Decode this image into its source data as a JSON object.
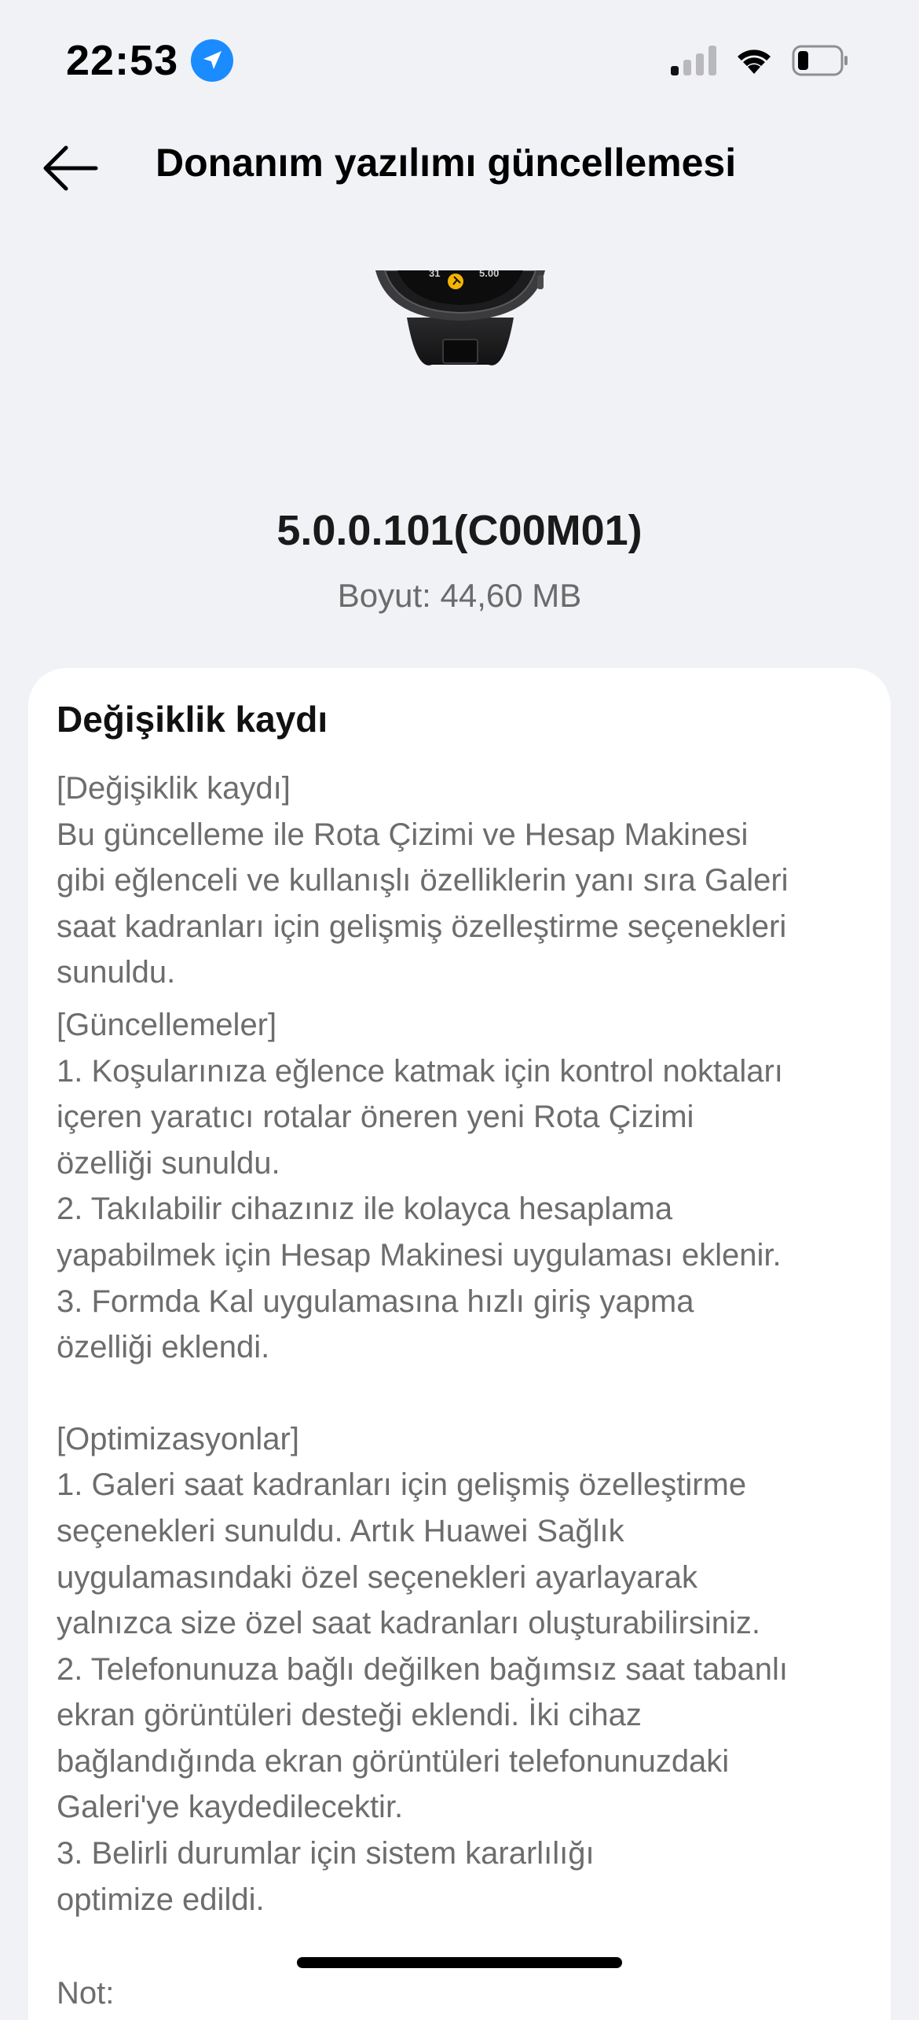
{
  "status_bar": {
    "time": "22:53",
    "location_icon": "location-arrow-icon",
    "signal_icon": "cellular-signal-icon",
    "wifi_icon": "wifi-icon",
    "battery_icon": "battery-low-icon",
    "battery_level": 0.2
  },
  "nav": {
    "back_icon": "arrow-left-icon",
    "title": "Donanım yazılımı güncellemesi"
  },
  "firmware": {
    "version": "5.0.0.101(C00M01)",
    "size": "Boyut: 44,60 MB"
  },
  "changelog": {
    "title": "Değişiklik kaydı",
    "header_tag": "[Değişiklik kaydı]",
    "intro": "Bu güncelleme ile Rota Çizimi ve Hesap Makinesi\ngibi eğlenceli ve kullanışlı özelliklerin yanı sıra Galeri\nsaat kadranları için gelişmiş özelleştirme seçenekleri\nsunuldu.",
    "updates_tag": "[Güncellemeler]",
    "updates": "1. Koşularınıza eğlence katmak için kontrol noktaları\niçeren yaratıcı rotalar öneren yeni Rota Çizimi\nözelliği sunuldu.\n2. Takılabilir cihazınız ile kolayca hesaplama\nyapabilmek için Hesap Makinesi uygulaması eklenir.\n3. Formda Kal uygulamasına hızlı giriş yapma\nözelliği eklendi.",
    "optimizations_tag": "[Optimizasyonlar]",
    "optimizations": "1. Galeri saat kadranları için gelişmiş özelleştirme\nseçenekleri sunuldu. Artık Huawei Sağlık\nuygulamasındaki özel seçenekleri ayarlayarak\nyalnızca size özel saat kadranları oluşturabilirsiniz.\n2. Telefonunuza bağlı değilken bağımsız saat tabanlı\nekran görüntüleri desteği eklendi. İki cihaz\nbağlandığında ekran görüntüleri telefonunuzdaki\nGaleri'ye kaydedilecektir.\n3. Belirli durumlar için sistem kararlılığı\noptimize edildi.",
    "cut_text": "Not:"
  },
  "device_image": {
    "dial_left": "31",
    "dial_right": "5.00"
  },
  "colors": {
    "background": "#f1f2f6",
    "card": "#ffffff",
    "accent": "#1a8cff",
    "body_text": "#6d6d6d"
  }
}
